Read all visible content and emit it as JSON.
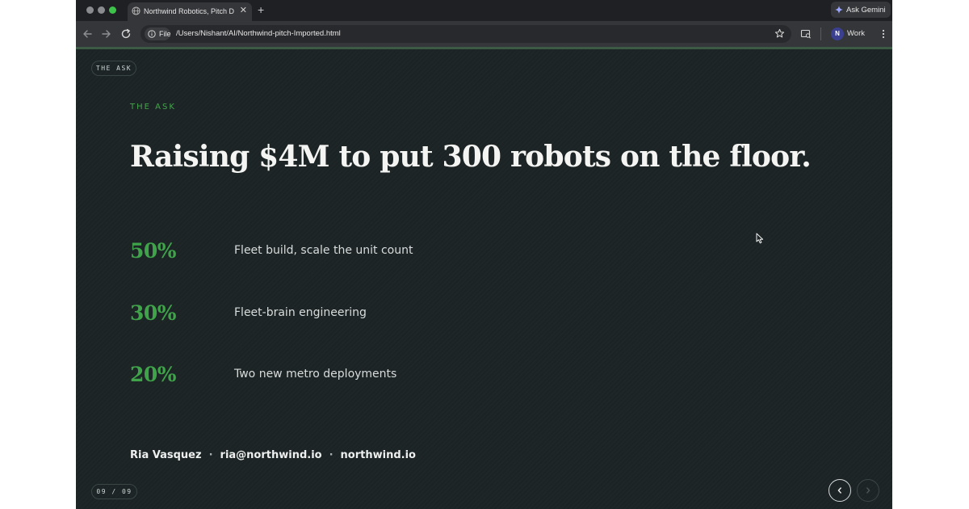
{
  "browser": {
    "tab_title": "Northwind Robotics, Pitch De",
    "tab_close": "✕",
    "new_tab": "+",
    "gemini_label": "Ask Gemini",
    "site_chip": "File",
    "url": "/Users/Nishant/AI/Northwind-pitch-Imported.html",
    "profile_initial": "N",
    "profile_name": "Work"
  },
  "slide": {
    "section_pill": "THE ASK",
    "eyebrow": "THE ASK",
    "headline": "Raising $4M to put 300 robots on the floor.",
    "allocations": [
      {
        "percent": "50%",
        "label": "Fleet build, scale the unit count"
      },
      {
        "percent": "30%",
        "label": "Fleet-brain engineering"
      },
      {
        "percent": "20%",
        "label": "Two new metro deployments"
      }
    ],
    "contact": {
      "name": "Ria Vasquez",
      "separator": "·",
      "email": "ria@northwind.io",
      "site": "northwind.io"
    },
    "page_counter": "09 / 09"
  },
  "colors": {
    "accent": "#3fa34a",
    "slide_bg": "#1b2325",
    "headline": "#f4f4f2"
  }
}
